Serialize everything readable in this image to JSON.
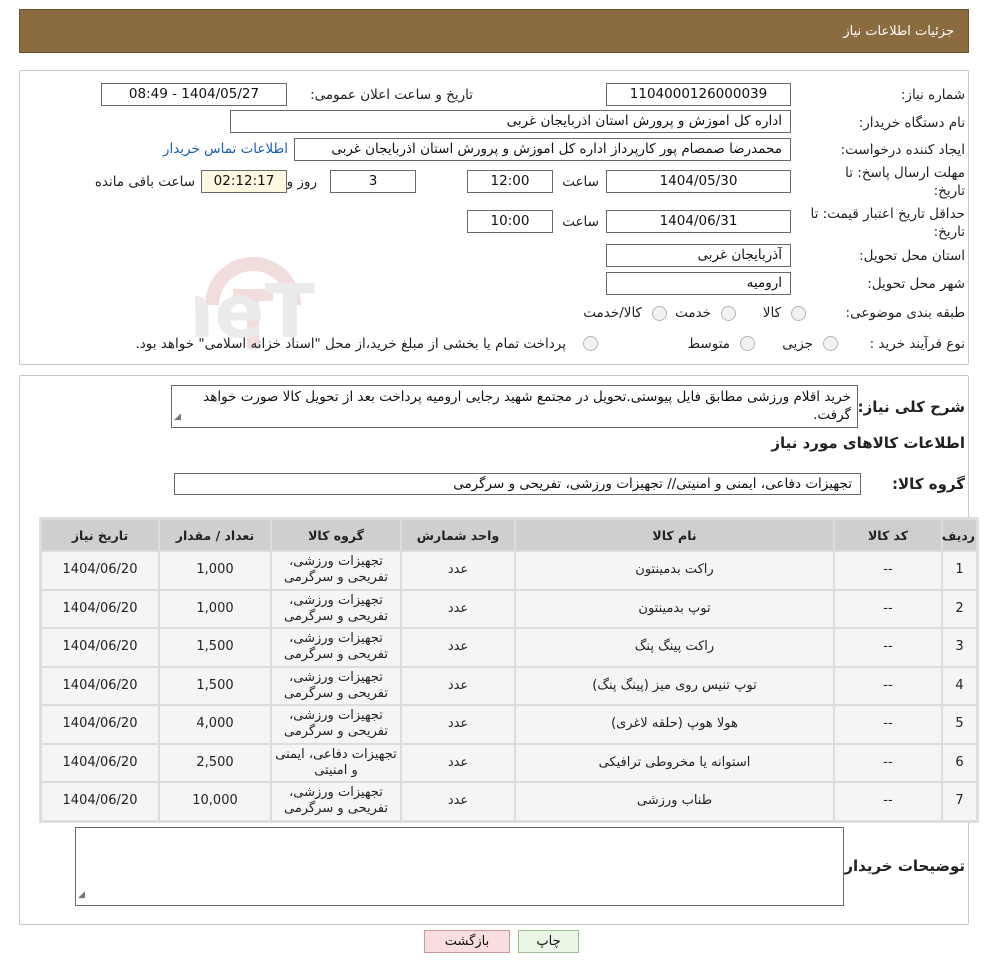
{
  "header": {
    "title": "جزئیات اطلاعات نیاز"
  },
  "watermark": {
    "text": "AriaTender.neT"
  },
  "form": {
    "need_number_label": "شماره نیاز:",
    "need_number": "1104000126000039",
    "announce_label": "تاریخ و ساعت اعلان عمومی:",
    "announce_value": "1404/05/27 - 08:49",
    "buyer_org_label": "نام دستگاه خریدار:",
    "buyer_org": "اداره کل اموزش و پرورش استان اذربایجان غربی",
    "creator_label": "ایجاد کننده درخواست:",
    "creator": "محمدرضا صمصام پور کارپرداز اداره کل اموزش و پرورش استان اذربایجان غربی",
    "contact_link": "اطلاعات تماس خریدار",
    "deadline_label_1": "مهلت ارسال پاسخ: تا",
    "deadline_label_2": "تاریخ:",
    "deadline_date": "1404/05/30",
    "time_label": "ساعت",
    "deadline_time": "12:00",
    "days_value": "3",
    "days_label": "روز و",
    "remaining_time": "02:12:17",
    "remaining_label": "ساعت باقی مانده",
    "validity_label_1": "حداقل تاریخ اعتبار قیمت: تا",
    "validity_label_2": "تاریخ:",
    "validity_date": "1404/06/31",
    "validity_time": "10:00",
    "province_label": "استان محل تحویل:",
    "province": "آذربایجان غربی",
    "city_label": "شهر محل تحویل:",
    "city": "ارومیه",
    "category_label": "طبقه بندی موضوعی:",
    "category_options": [
      "کالا",
      "خدمت",
      "کالا/خدمت"
    ],
    "process_label": "نوع فرآیند خرید :",
    "process_options": [
      "جزیی",
      "متوسط"
    ],
    "process_note": "پرداخت تمام یا بخشی از مبلغ خرید،از محل \"اسناد خزانه اسلامی\" خواهد بود."
  },
  "description": {
    "label": "شرح کلی نیاز:",
    "text": "خرید اقلام ورزشی مطابق فایل پیوستی.تحویل در مجتمع شهید رجایی ارومیه پرداخت بعد از تحویل کالا صورت خواهد گرفت."
  },
  "goods_section": {
    "title": "اطلاعات کالاهای مورد نیاز",
    "group_label": "گروه کالا:",
    "group_value": "تجهیزات دفاعی، ایمنی و امنیتی// تجهیزات ورزشی، تفریحی و سرگرمی"
  },
  "table": {
    "headers": [
      "ردیف",
      "کد کالا",
      "نام کالا",
      "واحد شمارش",
      "گروه کالا",
      "تعداد / مقدار",
      "تاریخ نیاز"
    ],
    "rows": [
      [
        "1",
        "--",
        "راکت بدمینتون",
        "عدد",
        "تجهیزات ورزشی، تفریحی و سرگرمی",
        "1,000",
        "1404/06/20"
      ],
      [
        "2",
        "--",
        "توپ بدمینتون",
        "عدد",
        "تجهیزات ورزشی، تفریحی و سرگرمی",
        "1,000",
        "1404/06/20"
      ],
      [
        "3",
        "--",
        "راکت پینگ پنگ",
        "عدد",
        "تجهیزات ورزشی، تفریحی و سرگرمی",
        "1,500",
        "1404/06/20"
      ],
      [
        "4",
        "--",
        "توپ تنیس روی میز (پینگ پنگ)",
        "عدد",
        "تجهیزات ورزشی، تفریحی و سرگرمی",
        "1,500",
        "1404/06/20"
      ],
      [
        "5",
        "--",
        "هولا هوپ (حلقه لاغری)",
        "عدد",
        "تجهیزات ورزشی، تفریحی و سرگرمی",
        "4,000",
        "1404/06/20"
      ],
      [
        "6",
        "--",
        "استوانه یا مخروطی ترافیکی",
        "عدد",
        "تجهیزات دفاعی، ایمنی و امنیتی",
        "2,500",
        "1404/06/20"
      ],
      [
        "7",
        "--",
        "طناب ورزشی",
        "عدد",
        "تجهیزات ورزشی، تفریحی و سرگرمی",
        "10,000",
        "1404/06/20"
      ]
    ]
  },
  "buyer_notes": {
    "label": "توضیحات خریدار:",
    "text": ""
  },
  "buttons": {
    "print": "چاپ",
    "back": "بازگشت"
  }
}
